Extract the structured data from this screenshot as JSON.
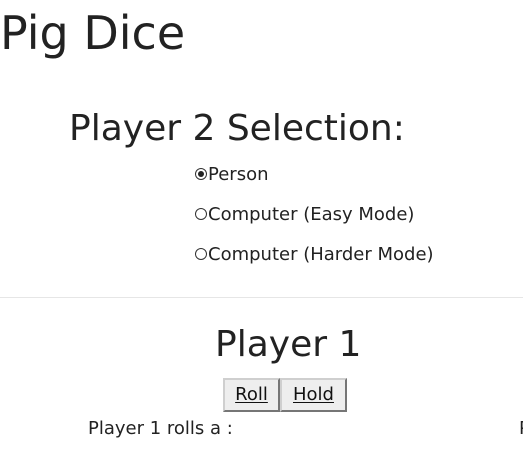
{
  "app": {
    "title": "Pig Dice"
  },
  "selection": {
    "heading": "Player 2 Selection:",
    "options": [
      {
        "label": "Person",
        "checked": true
      },
      {
        "label": "Computer (Easy Mode)",
        "checked": false
      },
      {
        "label": "Computer (Harder Mode)",
        "checked": false
      }
    ]
  },
  "player_panel": {
    "heading": "Player 1",
    "roll_label": "Roll",
    "hold_label": "Hold",
    "roll_status": "Player 1 rolls a :",
    "edge_text": "P"
  }
}
